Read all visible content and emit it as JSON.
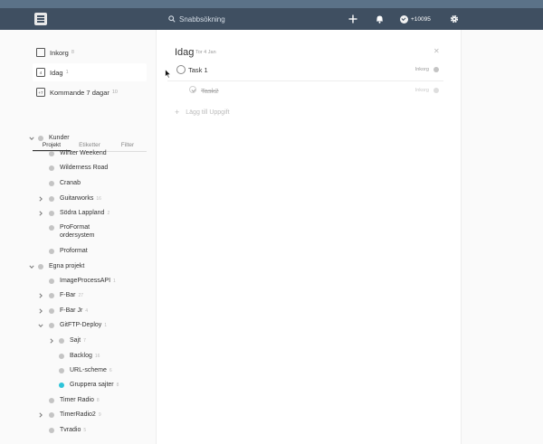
{
  "topbar": {
    "search_placeholder": "Snabbsökning",
    "karma": "+10095",
    "icons": [
      "todoist-logo-icon",
      "search-icon",
      "plus-icon",
      "bell-icon",
      "karma-icon",
      "gear-icon"
    ]
  },
  "nav": {
    "inbox": {
      "label": "Inkorg",
      "count": "8"
    },
    "today": {
      "label": "Idag",
      "count": "1",
      "icon_number": "4"
    },
    "next7": {
      "label": "Kommande 7 dagar",
      "count": "10",
      "icon_number": "+7"
    }
  },
  "tabs": [
    "Projekt",
    "Etiketter",
    "Filter"
  ],
  "projects": [
    {
      "name": "Kunder",
      "count": ""
    },
    {
      "name": "Winter Weekend",
      "count": ""
    },
    {
      "name": "Wilderness Road",
      "count": ""
    },
    {
      "name": "Cranab",
      "count": ""
    },
    {
      "name": "Guitarworks",
      "count": "16"
    },
    {
      "name": "Södra Lappland",
      "count": "2"
    },
    {
      "name": "ProFormat ordersystem",
      "count": ""
    },
    {
      "name": "Proformat",
      "count": ""
    },
    {
      "name": "Egna projekt",
      "count": ""
    },
    {
      "name": "ImageProcessAPI",
      "count": "1"
    },
    {
      "name": "F-Bar",
      "count": "27"
    },
    {
      "name": "F-Bar Jr",
      "count": "4"
    },
    {
      "name": "GitFTP-Deploy",
      "count": "1"
    },
    {
      "name": "Sajt",
      "count": "7"
    },
    {
      "name": "Backlog",
      "count": "16"
    },
    {
      "name": "URL-scheme",
      "count": "6"
    },
    {
      "name": "Gruppera sajter",
      "count": "8"
    },
    {
      "name": "Timer Radio",
      "count": "8"
    },
    {
      "name": "TimerRadio2",
      "count": "9"
    },
    {
      "name": "Tvradio",
      "count": "5"
    }
  ],
  "colors": {
    "accent_dot": "#2ec4d9",
    "topbar": "#3f4f61"
  },
  "main": {
    "title": "Idag",
    "date": "Tor 4 Jan",
    "tasks": [
      {
        "name": "Task 1",
        "project": "Inkorg",
        "done": false
      },
      {
        "name": "Task2",
        "project": "Inkorg",
        "done": true
      }
    ],
    "add_task_label": "Lägg till Uppgift"
  }
}
